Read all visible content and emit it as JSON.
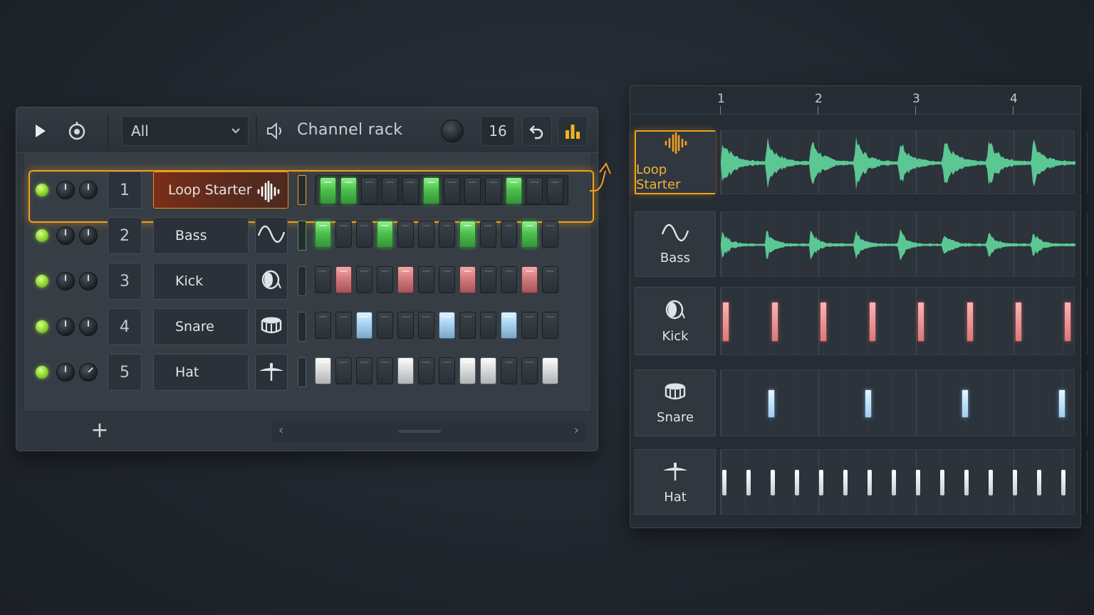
{
  "channel_rack": {
    "filter": {
      "value": "All",
      "options": [
        "All"
      ]
    },
    "title": "Channel rack",
    "steps_count": "16",
    "add_channel_label": "+",
    "scroll_left": "‹",
    "scroll_right": "›",
    "channels": [
      {
        "number": "1",
        "name": "Loop Starter",
        "icon": "waveform-icon",
        "selected": true,
        "steps": [
          1,
          1,
          0,
          0,
          0,
          1,
          0,
          0,
          0,
          1,
          0,
          0
        ],
        "color": "#4cc24d"
      },
      {
        "number": "2",
        "name": "Bass",
        "icon": "sine-wave-icon",
        "selected": false,
        "steps": [
          1,
          0,
          0,
          1,
          0,
          0,
          0,
          1,
          0,
          0,
          1,
          0
        ],
        "color": "#4cc24d"
      },
      {
        "number": "3",
        "name": "Kick",
        "icon": "kick-drum-icon",
        "selected": false,
        "steps": [
          0,
          1,
          0,
          0,
          1,
          0,
          0,
          1,
          0,
          0,
          1,
          0
        ],
        "color": "#d47a7e"
      },
      {
        "number": "4",
        "name": "Snare",
        "icon": "snare-drum-icon",
        "selected": false,
        "steps": [
          0,
          0,
          1,
          0,
          0,
          0,
          1,
          0,
          0,
          1,
          0,
          0
        ],
        "color": "#a9d2f0"
      },
      {
        "number": "5",
        "name": "Hat",
        "icon": "hi-hat-icon",
        "selected": false,
        "steps": [
          1,
          0,
          0,
          0,
          1,
          0,
          0,
          1,
          1,
          0,
          0,
          1
        ],
        "color": "#dcdcdc"
      }
    ]
  },
  "playlist": {
    "bar_labels": [
      "1",
      "2",
      "3",
      "4"
    ],
    "tracks": [
      {
        "name": "Loop Starter",
        "icon": "waveform-icon",
        "active": true
      },
      {
        "name": "Bass",
        "icon": "sine-wave-icon",
        "active": false
      },
      {
        "name": "Kick",
        "icon": "kick-drum-icon",
        "active": false
      },
      {
        "name": "Snare",
        "icon": "snare-drum-icon",
        "active": false
      },
      {
        "name": "Hat",
        "icon": "hi-hat-icon",
        "active": false
      }
    ]
  },
  "colors": {
    "accent": "#f0a020",
    "wave": "#5fd49a",
    "kick": "#e08a8e",
    "snare": "#a9d2f0",
    "hat": "#ffffff",
    "led": "#8bd22c"
  }
}
